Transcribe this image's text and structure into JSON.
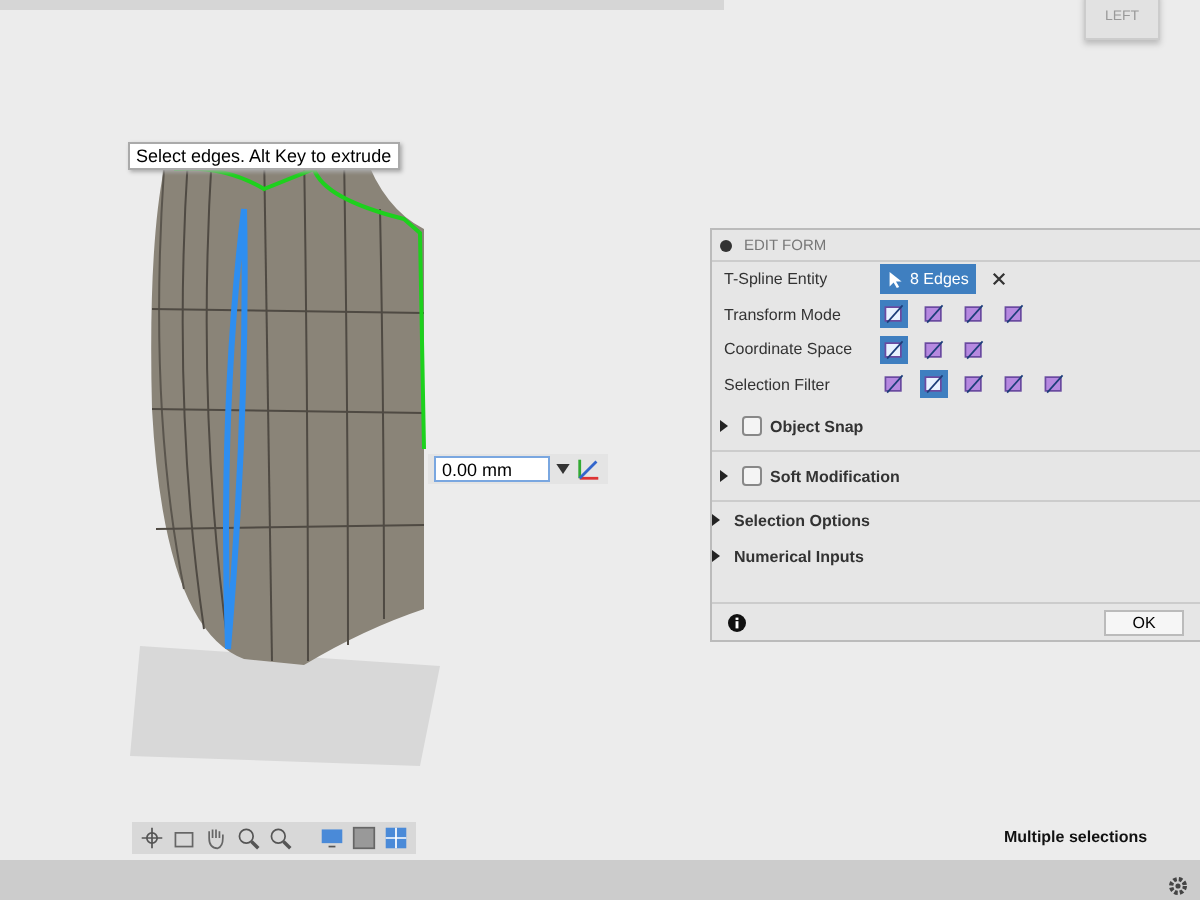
{
  "view_cube": {
    "label": "LEFT"
  },
  "tooltip": "Select edges. Alt Key to extrude",
  "distance_input": {
    "value": "0.00 mm"
  },
  "panel": {
    "title": "EDIT FORM",
    "rows": [
      {
        "label": "T-Spline Entity",
        "kind": "entity",
        "value": "8 Edges"
      },
      {
        "label": "Transform Mode",
        "kind": "icons",
        "icons": [
          {
            "selected": true
          },
          {
            "selected": false
          },
          {
            "selected": false
          },
          {
            "selected": false
          }
        ]
      },
      {
        "label": "Coordinate Space",
        "kind": "icons",
        "icons": [
          {
            "selected": true
          },
          {
            "selected": false
          },
          {
            "selected": false
          }
        ]
      },
      {
        "label": "Selection Filter",
        "kind": "icons",
        "icons": [
          {
            "selected": false
          },
          {
            "selected": true
          },
          {
            "selected": false
          },
          {
            "selected": false
          },
          {
            "selected": false
          }
        ]
      }
    ],
    "sections": [
      {
        "label": "Object Snap",
        "kind": "checkbox",
        "checked": false
      },
      {
        "label": "Soft Modification",
        "kind": "checkbox",
        "checked": false
      },
      {
        "label": "Selection Options",
        "kind": "plain"
      },
      {
        "label": "Numerical Inputs",
        "kind": "plain"
      }
    ],
    "ok": "OK"
  },
  "status": "Multiple selections"
}
